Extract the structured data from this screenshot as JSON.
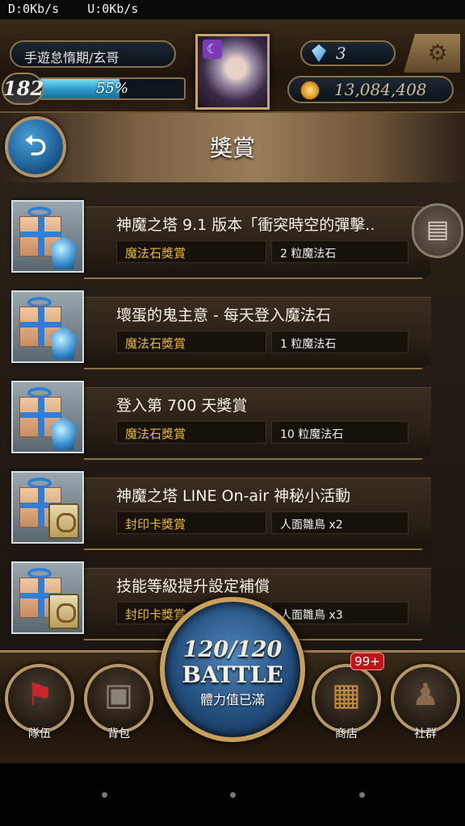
{
  "status_bar": {
    "download": "D:0Kb/s",
    "upload": "U:0Kb/s"
  },
  "player": {
    "name": "手遊怠惰期/玄哥",
    "level": "182",
    "exp_percent": "55%",
    "exp_fraction": 0.55,
    "magic_stones": "3",
    "gold": "13,084,408"
  },
  "page": {
    "title": "獎賞"
  },
  "rewards": [
    {
      "title": "神魔之塔 9.1 版本「衝突時空的彈擊..",
      "type": "魔法石獎賞",
      "amount": "2 粒魔法石",
      "icon": "gift-stone-icon"
    },
    {
      "title": "壞蛋的鬼主意 - 每天登入魔法石",
      "type": "魔法石獎賞",
      "amount": "1 粒魔法石",
      "icon": "gift-stone-icon"
    },
    {
      "title": "登入第 700 天獎賞",
      "type": "魔法石獎賞",
      "amount": "10 粒魔法石",
      "icon": "gift-stone-icon"
    },
    {
      "title": "神魔之塔 LINE On-air 神秘小活動",
      "type": "封印卡獎賞",
      "amount": "人面雛鳥 x2",
      "icon": "gift-card-icon"
    },
    {
      "title": "技能等級提升設定補償",
      "type": "封印卡獎賞",
      "amount": "人面雛鳥 x3",
      "icon": "gift-card-icon"
    }
  ],
  "nav": {
    "team": "隊伍",
    "bag": "背包",
    "shop": "商店",
    "social": "社群",
    "shop_badge": "99+"
  },
  "battle": {
    "stamina": "120/120",
    "label": "BATTLE",
    "status": "體力值已滿"
  },
  "colors": {
    "reward_type": "#e8b935",
    "exp_fill": "#2a98c8",
    "badge": "#c0141a",
    "battle_blue": "#244f7e"
  }
}
